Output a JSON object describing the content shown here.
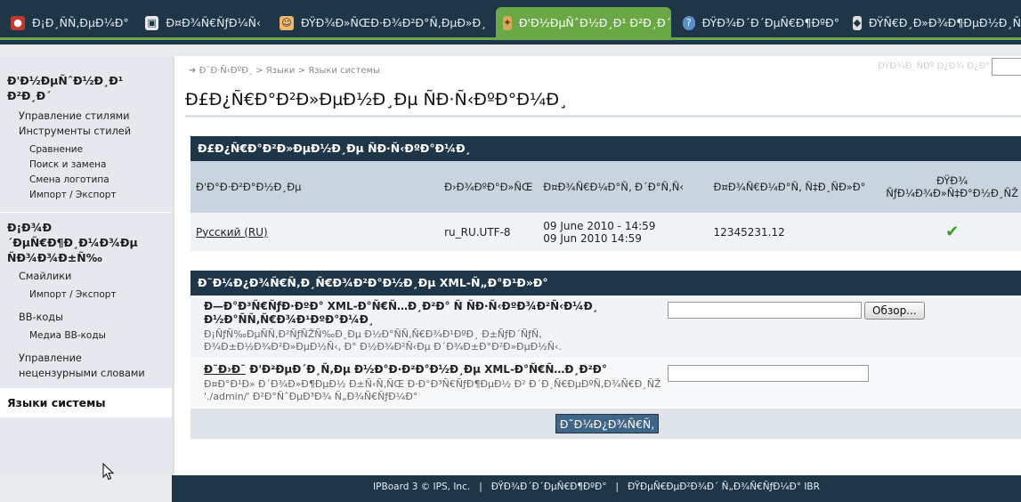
{
  "tabs": [
    {
      "label": "Ð¡Ð¸ÑÑ‚ÐµÐ¼Ð°",
      "icon": "system-icon",
      "color": "#c0392b"
    },
    {
      "label": "Ð¤Ð¾Ñ€ÑƒÐ¼Ñ‹",
      "icon": "forums-icon",
      "color": "#e9e9e9"
    },
    {
      "label": "ÐŸÐ¾Ð»ÑŒÐ·Ð¾Ð²Ð°Ñ‚ÐµÐ»Ð¸",
      "icon": "users-icon",
      "color": "#f3b76a"
    },
    {
      "label": "Ð'Ð½ÐµÑˆÐ½Ð¸Ð¹ Ð²Ð¸Ð´",
      "icon": "palette-icon",
      "color": "#d9a85b",
      "active": true
    },
    {
      "label": "ÐŸÐ¾Ð´Ð´ÐµÑ€Ð¶ÐºÐ°",
      "icon": "help-icon",
      "color": "#5b8fc7"
    },
    {
      "label": "ÐŸÑ€Ð¸Ð»Ð¾Ð¶ÐµÐ½Ð¸Ñ",
      "icon": "apps-icon",
      "color": "#dddddd"
    }
  ],
  "sidebar": {
    "group1_title": "Ð'Ð½ÐµÑˆÐ½Ð¸Ð¹ Ð²Ð¸Ð´",
    "group1_items": [
      "Управление стилями",
      "Инструменты стилей"
    ],
    "group1_subitems": [
      "Сравнение",
      "Поиск и замена",
      "Смена логотипа",
      "Импорт / Экспорт"
    ],
    "group2_title": "Ð¡Ð¾Ð´ÐµÑ€Ð¶Ð¸Ð¼Ð¾Ðµ ÑÐ¾Ð¾Ð±Ñ‰",
    "group2_item1": "Смайлики",
    "group2_sub1": "Импорт / Экспорт",
    "group2_item2": "BB-коды",
    "group2_sub2": "Медиа BB-коды",
    "group2_item3": "Управление нецензурными словами",
    "active_item": "Языки системы"
  },
  "breadcrumb": {
    "root": "Ð¯Ð·Ñ‹ÐºÐ¸",
    "sep": ">",
    "item1": "Языки",
    "item2": "Языки системы"
  },
  "quick_search_label": "ÐŸÐ¾Ð¸ÑÐº Ð¿Ð¾ Ð¿Ð°",
  "page_title": "Ð£Ð¿Ñ€Ð°Ð²Ð»ÐµÐ½Ð¸Ðµ ÑÐ·Ñ‹ÐºÐ°Ð¼Ð¸",
  "languages_table": {
    "heading": "Ð£Ð¿Ñ€Ð°Ð²Ð»ÐµÐ½Ð¸Ðµ ÑÐ·Ñ‹ÐºÐ°Ð¼Ð¸",
    "columns": [
      "Ð'Ð°Ð·Ð²Ð°Ð½Ð¸Ðµ",
      "Ð›Ð¾ÐºÐ°Ð»ÑŒ",
      "Ð¤Ð¾Ñ€Ð¼Ð°Ñ‚ Ð´Ð°Ñ‚Ñ‹",
      "Ð¤Ð¾Ñ€Ð¼Ð°Ñ‚ Ñ‡Ð¸ÑÐ»Ð°",
      "ÐŸÐ¾ ÑƒÐ¼Ð¾Ð»Ñ‡Ð°Ð½Ð¸ÑŽ"
    ],
    "rows": [
      {
        "name": "Русский (RU)",
        "locale": "ru_RU.UTF-8",
        "date1": "09 June 2010 - 14:59",
        "date2": "09 Jun 2010 14:59",
        "number": "12345231.12",
        "default": "✔"
      }
    ]
  },
  "import_form": {
    "heading": "Ð˜Ð¼Ð¿Ð¾Ñ€Ñ‚Ð¸Ñ€Ð¾Ð²Ð°Ð½Ð¸Ðµ XML-Ñ„Ð°Ð¹Ð»Ð°",
    "field1_label": "Ð—Ð°Ð³Ñ€ÑƒÐ·ÐºÐ° XML-Ð°Ñ€Ñ…Ð¸Ð²Ð° Ñ ÑÐ·Ñ‹ÐºÐ¾Ð²Ñ‹Ð¼Ð¸ Ð½Ð°ÑÑ‚Ñ€Ð¾Ð¹ÐºÐ°Ð¼Ð¸",
    "field1_desc": "Ð¡ÑƒÑ‰ÐµÑÑ‚Ð²ÑƒÑŽÑ‰Ð¸Ðµ Ð½Ð°ÑÑ‚Ñ€Ð¾Ð¹ÐºÐ¸ Ð±ÑƒÐ´ÑƒÑ‚ Ð¾Ð±Ð½Ð¾Ð²Ð»ÐµÐ½Ñ‹, Ð° Ð½Ð¾Ð²Ñ‹Ðµ Ð´Ð¾Ð±Ð°Ð²Ð»ÐµÐ½Ñ‹.",
    "browse_label": "Обзор...",
    "field2_label_link": "Ð˜Ð›Ð˜",
    "field2_label": "Ð'Ð²ÐµÐ´Ð¸Ñ‚Ðµ Ð½Ð°Ð·Ð²Ð°Ð½Ð¸Ðµ XML-Ð°Ñ€Ñ…Ð¸Ð²Ð°",
    "field2_desc": "Ð¤Ð°Ð¹Ð» Ð´Ð¾Ð»Ð¶ÐµÐ½ Ð±Ñ‹Ñ‚ÑŒ Ð·Ð°Ð³Ñ€ÑƒÐ¶ÐµÐ½ Ð² Ð´Ð¸Ñ€ÐµÐºÑ‚Ð¾Ñ€Ð¸ÑŽ './admin/' Ð²Ð°ÑˆÐµÐ³Ð¾ Ñ„Ð¾Ñ€ÑƒÐ¼Ð°",
    "submit_label": "Ð˜Ð¼Ð¿Ð¾Ñ€Ñ‚"
  },
  "footer": {
    "copyright": "IPBoard 3 © IPS, Inc.",
    "sep": "|",
    "support": "ÐŸÐ¾Ð´Ð´ÐµÑ€Ð¶ÐºÐ°",
    "translation": "ÐŸÐµÑ€ÐµÐ²Ð¾Ð´ Ñ„Ð¾Ñ€ÑƒÐ¼Ð° IBR"
  },
  "colors": {
    "nav_bg": "#1f3548",
    "active_tab": "#6aa845",
    "table_header": "#c8d4df",
    "check": "#3d9b28"
  }
}
